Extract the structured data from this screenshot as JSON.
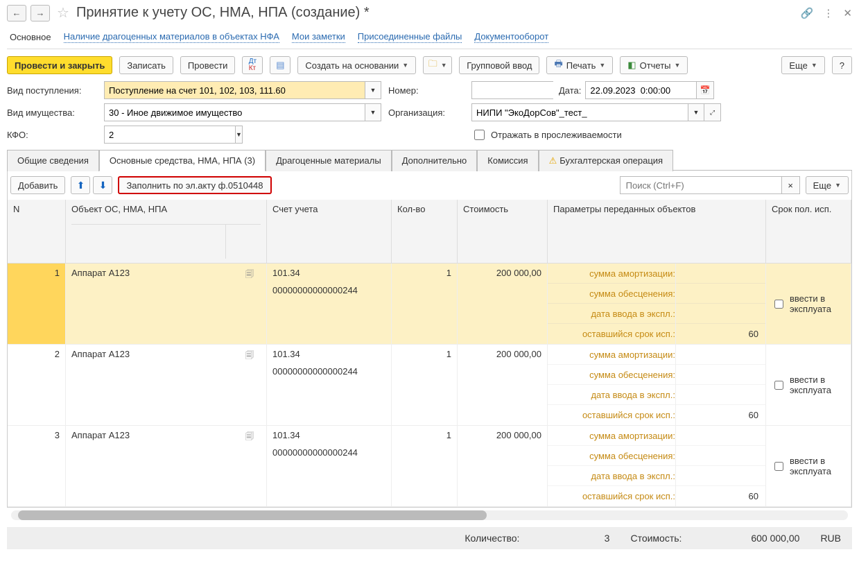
{
  "header": {
    "title": "Принятие к учету ОС, НМА, НПА (создание) *"
  },
  "linkbar": {
    "main": "Основное",
    "precious": "Наличие драгоценных материалов в объектах НФА",
    "notes": "Мои заметки",
    "files": "Присоединенные файлы",
    "docflow": "Документооборот"
  },
  "toolbar": {
    "post_close": "Провести и закрыть",
    "save": "Записать",
    "post": "Провести",
    "create_based": "Создать на основании",
    "group_input": "Групповой ввод",
    "print": "Печать",
    "reports": "Отчеты",
    "more": "Еще",
    "help": "?"
  },
  "form": {
    "receipt_type_lbl": "Вид поступления:",
    "receipt_type_val": "Поступление на счет 101, 102, 103, 111.60",
    "number_lbl": "Номер:",
    "number_val": "",
    "date_lbl": "Дата:",
    "date_val": "22.09.2023  0:00:00",
    "asset_type_lbl": "Вид имущества:",
    "asset_type_val": "30 - Иное движимое имущество",
    "org_lbl": "Организация:",
    "org_val": "НИПИ \"ЭкоДорСов\"_тест_",
    "kfo_lbl": "КФО:",
    "kfo_val": "2",
    "trace_lbl": "Отражать в прослеживаемости"
  },
  "tabs": {
    "general": "Общие сведения",
    "assets": "Основные средства, НМА, НПА (3)",
    "precious": "Драгоценные материалы",
    "extra": "Дополнительно",
    "commission": "Комиссия",
    "accounting": "Бухгалтерская операция"
  },
  "table_toolbar": {
    "add": "Добавить",
    "fill": "Заполнить по эл.акту ф.0510448",
    "search_ph": "Поиск (Ctrl+F)",
    "more": "Еще"
  },
  "columns": {
    "n": "N",
    "obj": "Объект ОС, НМА, НПА",
    "acct": "Счет учета",
    "qty": "Кол-во",
    "cost": "Стоимость",
    "params": "Параметры переданных объектов",
    "life": "Срок пол. исп."
  },
  "param_labels": {
    "amort": "сумма амортизации:",
    "impair": "сумма обесценения:",
    "date_in": "дата ввода в экспл.:",
    "remain": "оставшийся срок исп.:"
  },
  "rows": [
    {
      "n": "1",
      "obj": "Аппарат А123",
      "acct1": "101.34",
      "acct2": "00000000000000244",
      "qty": "1",
      "cost": "200 000,00",
      "remain": "60"
    },
    {
      "n": "2",
      "obj": "Аппарат А123",
      "acct1": "101.34",
      "acct2": "00000000000000244",
      "qty": "1",
      "cost": "200 000,00",
      "remain": "60"
    },
    {
      "n": "3",
      "obj": "Аппарат А123",
      "acct1": "101.34",
      "acct2": "00000000000000244",
      "qty": "1",
      "cost": "200 000,00",
      "remain": "60"
    }
  ],
  "row_action": {
    "enter_exploit": "ввести в эксплуата"
  },
  "footer": {
    "qty_lbl": "Количество:",
    "qty_val": "3",
    "cost_lbl": "Стоимость:",
    "cost_val": "600 000,00",
    "currency": "RUB"
  }
}
